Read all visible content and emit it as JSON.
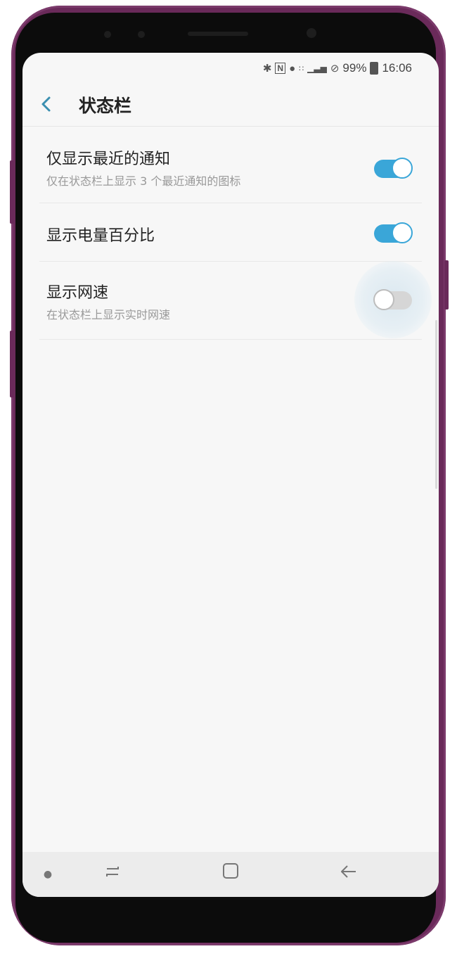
{
  "statusbar": {
    "icons": [
      "bluetooth-icon",
      "nfc-icon",
      "alarm-icon",
      "wifi-icon",
      "signal-icon",
      "do-not-disturb-icon",
      "battery-icon"
    ],
    "battery_text": "99%",
    "time": "16:06"
  },
  "header": {
    "title": "状态栏"
  },
  "settings": [
    {
      "label": "仅显示最近的通知",
      "sub": "仅在状态栏上显示 3 个最近通知的图标",
      "enabled": true
    },
    {
      "label": "显示电量百分比",
      "sub": "",
      "enabled": true
    },
    {
      "label": "显示网速",
      "sub": "在状态栏上显示实时网速",
      "enabled": false
    }
  ],
  "navbar": {
    "items": [
      "dot-indicator",
      "recent-apps-icon",
      "home-icon",
      "back-icon"
    ]
  },
  "colors": {
    "accent": "#3aa6d8",
    "frame": "#6a2a5a",
    "background": "#f7f7f7"
  }
}
